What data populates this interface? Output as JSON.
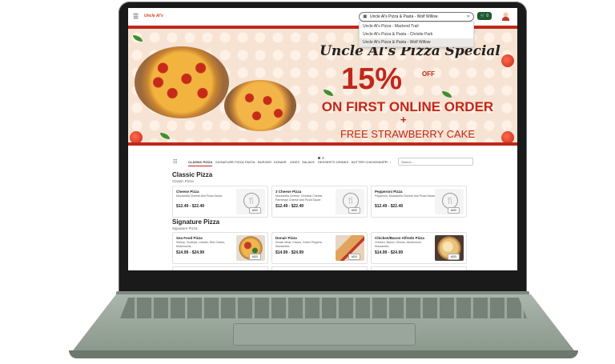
{
  "header": {
    "logo_text": "Uncle Al's",
    "location_selected": "Uncle Al's Pizza & Pasta - Wolf Willow",
    "cart_count": "0",
    "location_options": [
      "Uncle Al's Pizza - Macleod Trail",
      "Uncle Al's Pizza & Pasta - Christie Park",
      "Uncle Al's Pizza & Pasta - Wolf Willow"
    ]
  },
  "banner": {
    "title": "Uncle Al's Pizza Special",
    "percent": "15%",
    "off": "OFF",
    "line1": "ON FIRST ONLINE ORDER",
    "plus": "+",
    "line2": "FREE STRAWBERRY CAKE"
  },
  "categories": [
    "CLASSIC PIZZA",
    "SIGNATURE PIZZA",
    "PASTA",
    "BURGER",
    "DONAIR",
    "SIDES",
    "SALADS",
    "DESSERTS",
    "DRINKS",
    "BUTTER CHICKEN",
    "DIPPI"
  ],
  "search_placeholder": "Search...",
  "sections": [
    {
      "title": "Classic Pizza",
      "subtitle": "Classic Pizza",
      "items": [
        {
          "name": "Cheese Pizza",
          "desc": "Mozzarella Cheese And Pizza Sauce",
          "price": "$12.49 - $22.49",
          "add": "ADD"
        },
        {
          "name": "3 Cheese Pizza",
          "desc": "Mozzarella Cheese, Cheddar Cheese, Parmesan Cheese And Pizza Sauce",
          "price": "$12.49 - $22.49",
          "add": "ADD"
        },
        {
          "name": "Pepperoni Pizza",
          "desc": "Pepperoni, Mozzarella Cheese And Pizza Sauce",
          "price": "$12.49 - $22.49",
          "add": "ADD"
        }
      ]
    },
    {
      "title": "Signature Pizza",
      "subtitle": "Signature Pizza",
      "items": [
        {
          "name": "Sea Food Pizza",
          "desc": "Shrimp, Scallops, Lobster, Red Onions, Mushrooms...",
          "price": "$14.99 - $24.99",
          "add": "ADD"
        },
        {
          "name": "Donair Pizza",
          "desc": "Donair Meat, Onions, Green Peppers, Mozzarella...",
          "price": "$14.99 - $24.99",
          "add": "ADD"
        },
        {
          "name": "Chicken/Bacon Alfredo Pizza",
          "desc": "Chicken, Bacon, Onions, Mushrooms, Mozzarella...",
          "price": "$14.99 - $24.99",
          "add": "ADD"
        }
      ]
    }
  ]
}
